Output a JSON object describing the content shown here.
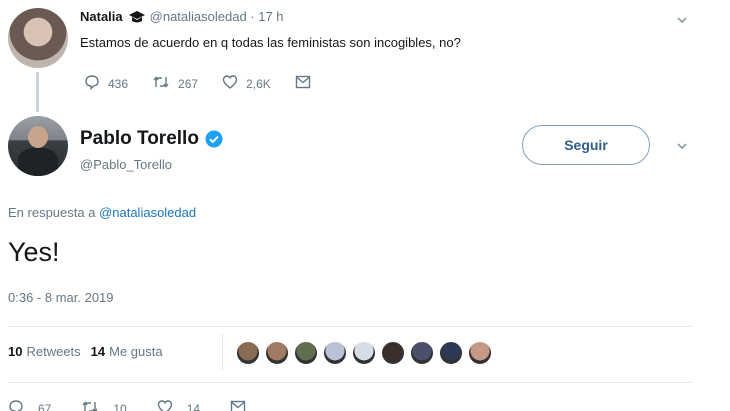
{
  "parent_tweet": {
    "name": "Natalia",
    "handle": "@nataliasoledad · 17 h",
    "text": "Estamos de acuerdo en q todas las feministas son incogibles, no?",
    "replies": "436",
    "retweets": "267",
    "likes": "2,6K",
    "icons": [
      "graduation-cap-icon",
      "reply-icon",
      "retweet-icon",
      "like-icon",
      "message-icon",
      "chevron-down-icon"
    ]
  },
  "main_tweet": {
    "name": "Pablo Torello",
    "handle": "@Pablo_Torello",
    "follow_label": "Seguir",
    "reply_prefix": "En respuesta a ",
    "reply_target": "@nataliasoledad",
    "text": "Yes!",
    "timestamp": "0:36 - 8 mar. 2019",
    "stats": {
      "retweet_count": "10",
      "retweet_label": "Retweets",
      "like_count": "14",
      "like_label": "Me gusta"
    },
    "bottom_actions": {
      "replies": "67",
      "retweets": "10",
      "likes": "14"
    }
  },
  "colors": {
    "link": "#1b75bb",
    "verified": "#1da1f2",
    "muted": "#657786",
    "follow_border": "#7aa0bf"
  },
  "likers": [
    {
      "color": "#8a6b52"
    },
    {
      "color": "#a07a63"
    },
    {
      "color": "#5e6e4e"
    },
    {
      "color": "#b9c2d6"
    },
    {
      "color": "#d7dde6"
    },
    {
      "color": "#3b2f2a"
    },
    {
      "color": "#4a4f6b"
    },
    {
      "color": "#2d3a55"
    },
    {
      "color": "#c79a86"
    }
  ]
}
